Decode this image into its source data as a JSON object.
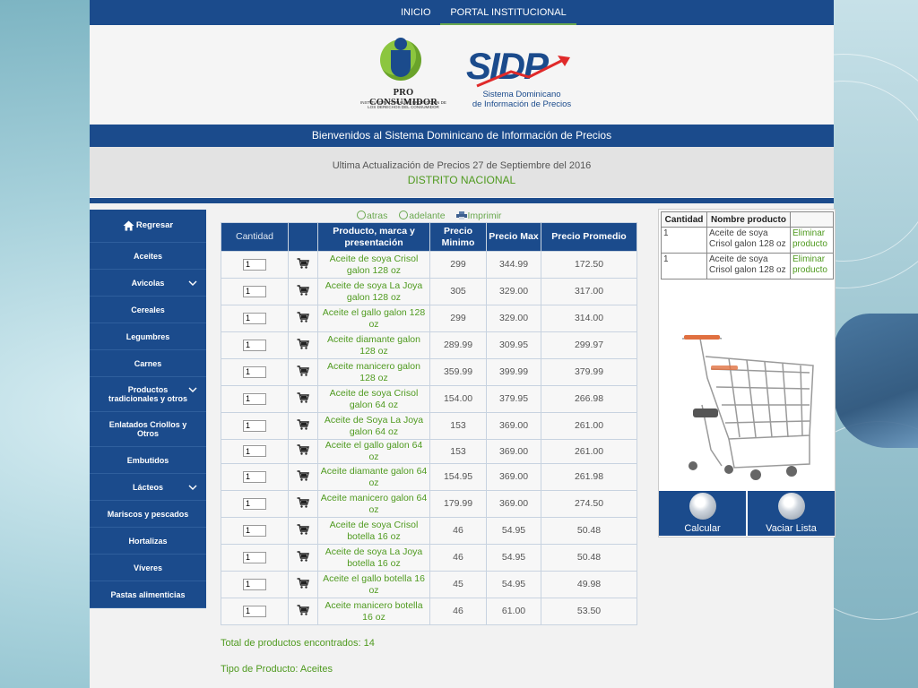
{
  "nav": {
    "home": "INICIO",
    "portal": "PORTAL INSTITUCIONAL"
  },
  "logos": {
    "proconsumidor_name": "PRO CONSUMIDOR",
    "proconsumidor_sub": "Instituto Nacional de Protección de los Derechos del Consumidor",
    "sidp_mark": "SIDP",
    "sidp_sub_line1": "Sistema Dominicano",
    "sidp_sub_line2": "de Información de Precios"
  },
  "welcome": "Bienvenidos al Sistema Dominicano de Información de Precios",
  "update_text": "Ultima Actualización de Precios 27 de Septiembre del 2016",
  "region": "DISTRITO NACIONAL",
  "sidebar": [
    "Regresar",
    "Aceites",
    "Avicolas",
    "Cereales",
    "Legumbres",
    "Carnes",
    "Productos tradicionales y otros",
    "Enlatados Criollos y Otros",
    "Embutidos",
    "Lácteos",
    "Mariscos y pescados",
    "Hortalizas",
    "Víveres",
    "Pastas alimenticias"
  ],
  "toolbar": {
    "back": "atras",
    "forward": "adelante",
    "print": "Imprimir"
  },
  "table": {
    "headers": {
      "qty": "Cantidad",
      "product": "Producto, marca y presentación",
      "min": "Precio Minimo",
      "max": "Precio Max",
      "avg": "Precio Promedio"
    },
    "rows": [
      {
        "qty": "1",
        "name": "Aceite de soya Crisol galon 128 oz",
        "min": "299",
        "max": "344.99",
        "avg": "172.50"
      },
      {
        "qty": "1",
        "name": "Aceite de soya La Joya galon 128 oz",
        "min": "305",
        "max": "329.00",
        "avg": "317.00"
      },
      {
        "qty": "1",
        "name": "Aceite el gallo galon 128 oz",
        "min": "299",
        "max": "329.00",
        "avg": "314.00"
      },
      {
        "qty": "1",
        "name": "Aceite diamante galon 128 oz",
        "min": "289.99",
        "max": "309.95",
        "avg": "299.97"
      },
      {
        "qty": "1",
        "name": "Aceite manicero galon 128 oz",
        "min": "359.99",
        "max": "399.99",
        "avg": "379.99"
      },
      {
        "qty": "1",
        "name": "Aceite de soya Crisol galon 64 oz",
        "min": "154.00",
        "max": "379.95",
        "avg": "266.98"
      },
      {
        "qty": "1",
        "name": "Aceite de Soya La Joya galon 64 oz",
        "min": "153",
        "max": "369.00",
        "avg": "261.00"
      },
      {
        "qty": "1",
        "name": "Aceite el gallo galon 64 oz",
        "min": "153",
        "max": "369.00",
        "avg": "261.00"
      },
      {
        "qty": "1",
        "name": "Aceite diamante galon 64 oz",
        "min": "154.95",
        "max": "369.00",
        "avg": "261.98"
      },
      {
        "qty": "1",
        "name": "Aceite manicero galon 64 oz",
        "min": "179.99",
        "max": "369.00",
        "avg": "274.50"
      },
      {
        "qty": "1",
        "name": "Aceite de soya Crisol botella 16 oz",
        "min": "46",
        "max": "54.95",
        "avg": "50.48"
      },
      {
        "qty": "1",
        "name": "Aceite de soya La Joya botella 16 oz",
        "min": "46",
        "max": "54.95",
        "avg": "50.48"
      },
      {
        "qty": "1",
        "name": "Aceite el gallo botella 16 oz",
        "min": "45",
        "max": "54.95",
        "avg": "49.98"
      },
      {
        "qty": "1",
        "name": "Aceite manicero botella 16 oz",
        "min": "46",
        "max": "61.00",
        "avg": "53.50"
      }
    ]
  },
  "footer": {
    "total": "Total de productos encontrados: 14",
    "type": "Tipo de Producto: Aceites"
  },
  "list": {
    "headers": {
      "qty": "Cantidad",
      "name": "Nombre producto",
      "action": ""
    },
    "rows": [
      {
        "qty": "1",
        "name": "Aceite de soya Crisol galon 128 oz",
        "action": "Eliminar producto"
      },
      {
        "qty": "1",
        "name": "Aceite de soya Crisol galon 128 oz",
        "action": "Eliminar producto"
      }
    ]
  },
  "actions": {
    "calc": "Calcular",
    "clear": "Vaciar Lista"
  },
  "icons": [
    "home-icon",
    "chevron-down-icon",
    "back-circle-icon",
    "forward-circle-icon",
    "printer-icon",
    "add-to-cart-icon",
    "shopping-cart-image",
    "calculator-icon",
    "trash-icon"
  ],
  "colors": {
    "primary_blue": "#1b4b8c",
    "accent_green": "#4f9a1f"
  }
}
